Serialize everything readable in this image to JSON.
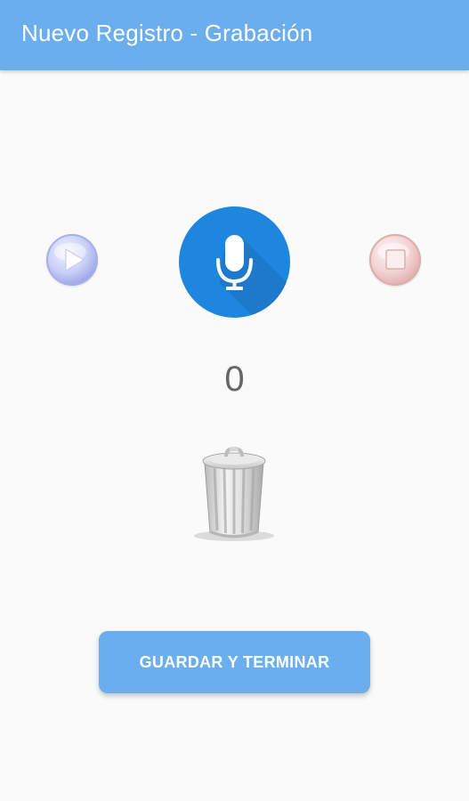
{
  "appbar": {
    "title": "Nuevo Registro - Grabación",
    "color": "#6aaeed"
  },
  "controls": {
    "play_icon": "play-icon",
    "record_icon": "microphone-icon",
    "stop_icon": "stop-icon",
    "record_color": "#1f86dd"
  },
  "counter": {
    "value": "0"
  },
  "trash": {
    "icon": "trash-can-icon"
  },
  "actions": {
    "save_label": "GUARDAR Y TERMINAR"
  }
}
